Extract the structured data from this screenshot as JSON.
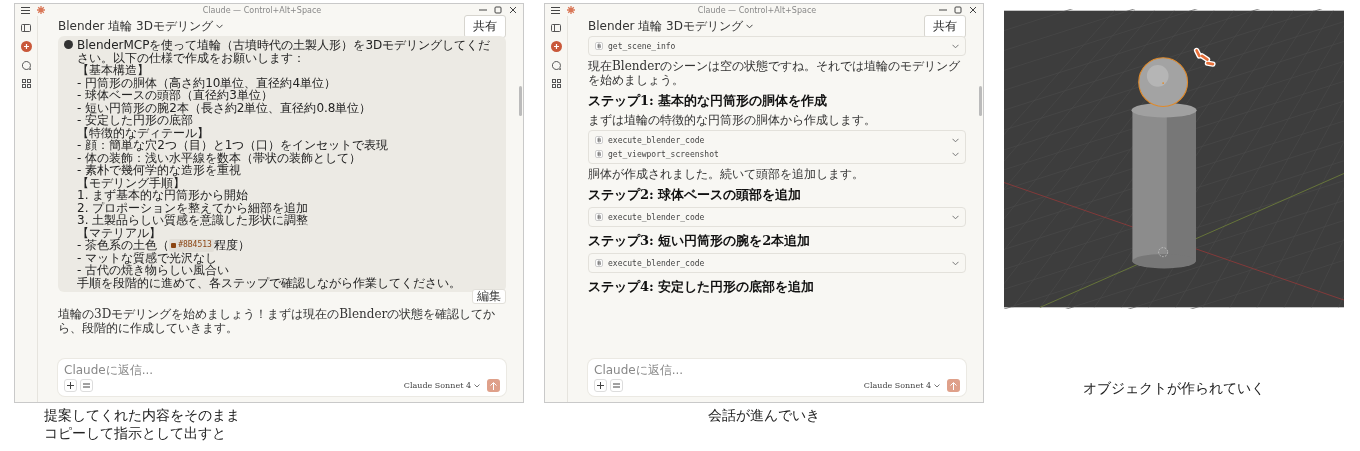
{
  "panels": [
    {
      "kind": "chat_prompt",
      "window": {
        "title": "Claude — Control+Alt+Space"
      },
      "conversation_title": "Blender 埴輪 3Dモデリング",
      "share_button": "共有",
      "message": {
        "lines": [
          {
            "kind": "text",
            "text": "BlenderMCPを使って埴輪（古墳時代の土製人形）を3Dモデリングしてください。以下の仕様で作成をお願いします："
          },
          {
            "kind": "text",
            "text": "【基本構造】"
          },
          {
            "kind": "text",
            "text": "- 円筒形の胴体（高さ約10単位、直径約4単位）"
          },
          {
            "kind": "text",
            "text": "- 球体ベースの頭部（直径約3単位）"
          },
          {
            "kind": "text",
            "text": "- 短い円筒形の腕2本（長さ約2単位、直径約0.8単位）"
          },
          {
            "kind": "text",
            "text": "- 安定した円形の底部"
          },
          {
            "kind": "text",
            "text": "【特徴的なディテール】"
          },
          {
            "kind": "text",
            "text": "- 顔：簡単な穴2つ（目）と1つ（口）をインセットで表現"
          },
          {
            "kind": "text",
            "text": "- 体の装飾：浅い水平線を数本（帯状の装飾として）"
          },
          {
            "kind": "text",
            "text": "- 素朴で幾何学的な造形を重視"
          },
          {
            "kind": "text",
            "text": "【モデリング手順】"
          },
          {
            "kind": "text",
            "text": "1. まず基本的な円筒形から開始"
          },
          {
            "kind": "text",
            "text": "2. プロポーションを整えてから細部を追加"
          },
          {
            "kind": "text",
            "text": "3. 土製品らしい質感を意識した形状に調整"
          },
          {
            "kind": "text",
            "text": "【マテリアル】"
          },
          {
            "kind": "color",
            "before": "- 茶色系の土色（",
            "color": "#8b4513",
            "code": "#8B4513",
            "after": "程度）"
          },
          {
            "kind": "text",
            "text": "- マットな質感で光沢なし"
          },
          {
            "kind": "text",
            "text": "- 古代の焼き物らしい風合い"
          },
          {
            "kind": "text",
            "text": "手順を段階的に進めて、各ステップで確認しながら作業してください。"
          }
        ]
      },
      "edit_label": "編集",
      "items": [
        {
          "kind": "paragraph",
          "text": "埴輪の3Dモデリングを始めましょう！まずは現在のBlenderの状態を確認してから、段階的に作成していきます。"
        }
      ],
      "input": {
        "placeholder": "Claudeに返信...",
        "model": "Claude Sonnet 4"
      },
      "caption": [
        "提案してくれた内容をそのまま",
        "コピーして指示として出すと"
      ]
    },
    {
      "kind": "chat_steps",
      "window": {
        "title": "Claude — Control+Alt+Space"
      },
      "conversation_title": "Blender 埴輪 3Dモデリング",
      "share_button": "共有",
      "items": [
        {
          "kind": "tools",
          "tools": [
            "get_scene_info"
          ]
        },
        {
          "kind": "paragraph",
          "text": "現在Blenderのシーンは空の状態ですね。それでは埴輪のモデリングを始めましょう。"
        },
        {
          "kind": "heading",
          "text": "ステップ1: 基本的な円筒形の胴体を作成"
        },
        {
          "kind": "paragraph",
          "text": "まずは埴輪の特徴的な円筒形の胴体から作成します。"
        },
        {
          "kind": "tools",
          "tools": [
            "execute_blender_code",
            "get_viewport_screenshot"
          ]
        },
        {
          "kind": "paragraph",
          "text": "胴体が作成されました。続いて頭部を追加します。"
        },
        {
          "kind": "heading",
          "text": "ステップ2: 球体ベースの頭部を追加"
        },
        {
          "kind": "tools",
          "tools": [
            "execute_blender_code"
          ]
        },
        {
          "kind": "heading",
          "text": "ステップ3: 短い円筒形の腕を2本追加"
        },
        {
          "kind": "tools",
          "tools": [
            "execute_blender_code"
          ]
        },
        {
          "kind": "heading",
          "text": "ステップ4: 安定した円形の底部を追加"
        }
      ],
      "input": {
        "placeholder": "Claudeに返信...",
        "model": "Claude Sonnet 4"
      },
      "caption": [
        "会話が進んでいき"
      ]
    },
    {
      "kind": "viewport",
      "caption": [
        "オブジェクトが作られていく"
      ]
    }
  ]
}
